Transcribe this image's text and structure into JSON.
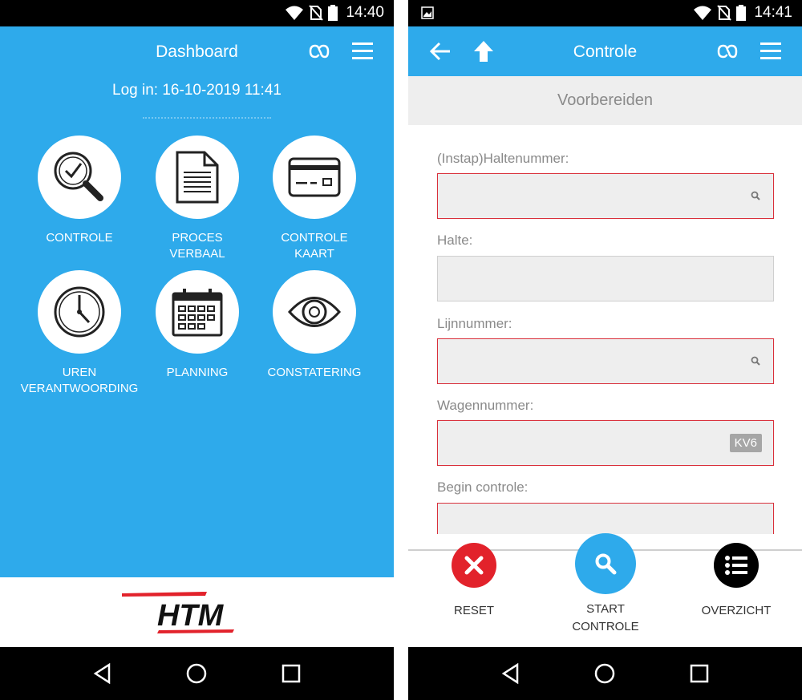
{
  "left": {
    "status": {
      "time": "14:40"
    },
    "header": {
      "title": "Dashboard"
    },
    "login_text": "Log in: 16-10-2019 11:41",
    "tiles": [
      {
        "label": "CONTROLE",
        "icon": "magnifier-check-icon"
      },
      {
        "label": "PROCES\nVERBAAL",
        "icon": "document-icon"
      },
      {
        "label": "CONTROLE\nKAART",
        "icon": "card-icon"
      },
      {
        "label": "UREN\nVERANTWOORDING",
        "icon": "clock-icon"
      },
      {
        "label": "PLANNING",
        "icon": "calendar-icon"
      },
      {
        "label": "CONSTATERING",
        "icon": "eye-icon"
      }
    ],
    "brand": "HTM"
  },
  "right": {
    "status": {
      "time": "14:41"
    },
    "header": {
      "title": "Controle"
    },
    "section": "Voorbereiden",
    "fields": [
      {
        "label": "(Instap)Haltenummer:",
        "value": ""
      },
      {
        "label": "Halte:",
        "value": ""
      },
      {
        "label": "Lijnnummer:",
        "value": ""
      },
      {
        "label": "Wagennummer:",
        "value": "",
        "badge": "KV6"
      },
      {
        "label": "Begin controle:",
        "value": ""
      }
    ],
    "actions": [
      {
        "label": "RESET",
        "color": "#e2222b"
      },
      {
        "label": "START\nCONTROLE",
        "color": "#2eaaeb"
      },
      {
        "label": "OVERZICHT",
        "color": "#000000"
      }
    ]
  },
  "colors": {
    "primary": "#2eaaeb",
    "error": "#d9303b",
    "brand_red": "#e2222b"
  }
}
